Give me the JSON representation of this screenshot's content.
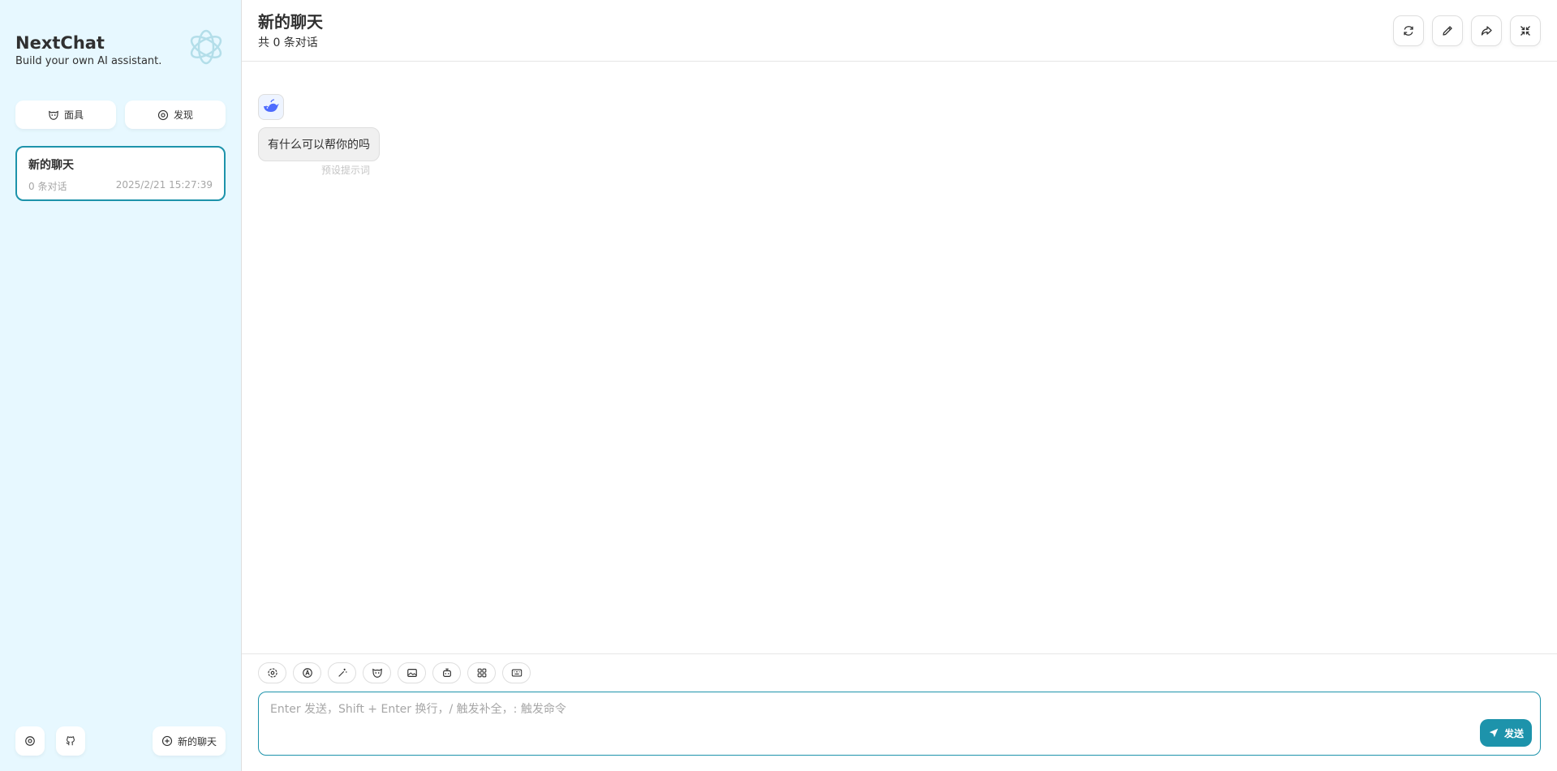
{
  "sidebar": {
    "brand_title": "NextChat",
    "brand_subtitle": "Build your own AI assistant.",
    "mask_button_label": "面具",
    "discover_button_label": "发现",
    "chat_items": [
      {
        "title": "新的聊天",
        "count": "0 条对话",
        "time": "2025/2/21 15:27:39"
      }
    ],
    "new_chat_label": "新的聊天"
  },
  "header": {
    "title": "新的聊天",
    "subtitle": "共 0 条对话"
  },
  "messages": [
    {
      "role": "assistant",
      "text": "有什么可以帮你的吗",
      "note": "预设提示词"
    }
  ],
  "input": {
    "placeholder": "Enter 发送，Shift + Enter 换行，/ 触发补全，: 触发命令",
    "value": "",
    "send_label": "发送"
  },
  "colors": {
    "sidebar_bg": "#e7f8ff",
    "accent": "#1d93ab",
    "bubble_bg": "#f0f0f0"
  },
  "icons": {
    "toolbar": [
      "settings-icon",
      "auto-icon",
      "magic-wand-icon",
      "mask-icon",
      "image-icon",
      "robot-icon",
      "grid-icon",
      "keyboard-icon"
    ],
    "header": [
      "refresh-icon",
      "edit-icon",
      "share-icon",
      "collapse-icon"
    ]
  }
}
